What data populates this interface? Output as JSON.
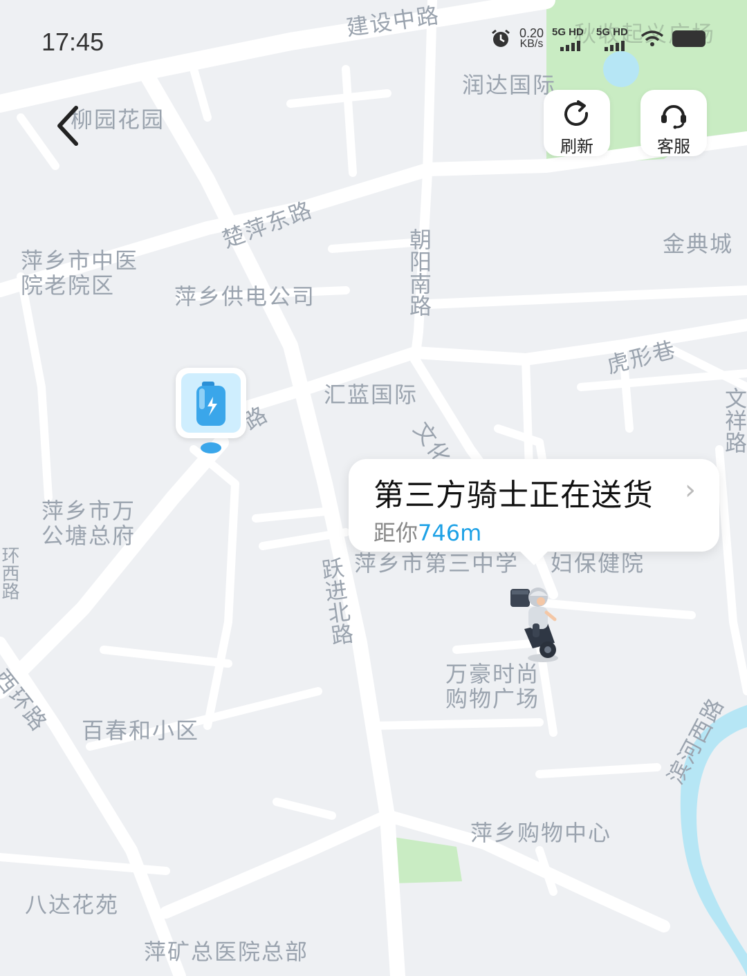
{
  "status_bar": {
    "time": "17:45",
    "net_speed_value": "0.20",
    "net_speed_unit": "KB/s",
    "signal_1": "5G HD",
    "signal_2": "5G HD"
  },
  "toolbar": {
    "refresh_label": "刷新",
    "service_label": "客服"
  },
  "map": {
    "labels": {
      "jianshe_zhonglu": "建设中路",
      "qiushou_guangchang": "秋收起义广场",
      "runda_guoji": "润达国际",
      "liuyuan_huayuan": "柳园花园",
      "chuping_donglu": "楚萍东路",
      "jindian_cheng": "金典城",
      "zhongyiyuan": "萍乡市中医\n院老院区",
      "gongdian": "萍乡供电公司",
      "chaoyang_nanlu": "朝阳南路",
      "huxing_xiang": "虎形巷",
      "huilan_guoji": "汇蓝国际",
      "wenxiang_lu": "文祥路",
      "wenhua_lu": "文化路",
      "road_partial": "路",
      "wantang": "萍乡市万\n公塘总府",
      "disan_zhongxue": "萍乡市第三中学",
      "fubao": "妇保健院",
      "yuejin_beilu": "跃进北路",
      "wanhao": "万豪时尚\n购物广场",
      "xihuan_lu": "西环路",
      "baichun": "百春和小区",
      "binhe_xilu": "滨河西路",
      "gouwu_zhongxin": "萍乡购物中心",
      "bada_huayuan": "八达花苑",
      "pingkuang": "萍矿总医院总部",
      "left_road": "环西路"
    },
    "colors": {
      "background": "#eef0f3",
      "road": "#ffffff",
      "park": "#c9ecc3",
      "water": "#b6e6f5",
      "accent": "#1da1e6"
    }
  },
  "delivery_card": {
    "title": "第三方骑士正在送货",
    "distance_prefix": "距你",
    "distance_value": "746m"
  },
  "icons": [
    "back-arrow-icon",
    "refresh-icon",
    "headset-icon",
    "battery-marker-icon",
    "rider-icon",
    "chevron-right-icon",
    "alarm-icon",
    "wifi-icon",
    "battery-icon"
  ]
}
